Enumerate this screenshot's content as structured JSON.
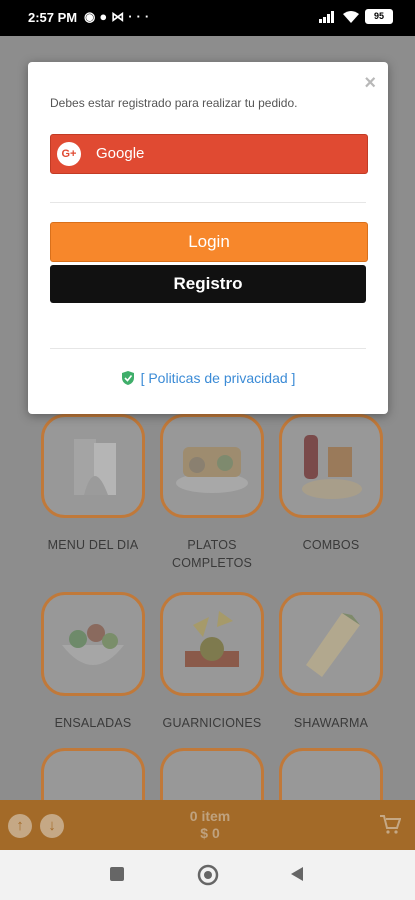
{
  "status_bar": {
    "time": "2:57 PM",
    "left_icons": [
      "whatsapp-icon",
      "chat-icon",
      "sync-icon",
      "more-dots-icon"
    ],
    "battery": "95"
  },
  "modal": {
    "message": "Debes estar registrado para realizar tu pedido.",
    "close": "×",
    "google_icon": "G+",
    "google_label": "Google",
    "login_label": "Login",
    "registro_label": "Registro",
    "privacy_label": "[ Politicas de privacidad ]",
    "colors": {
      "google": "#e04a32",
      "login": "#f7872b",
      "registro": "#111111",
      "link": "#3b8bd6"
    }
  },
  "categories": [
    {
      "label": "MENU DEL DIA",
      "icon": "menu-card-icon"
    },
    {
      "label": "PLATOS\nCOMPLETOS",
      "icon": "platter-icon"
    },
    {
      "label": "COMBOS",
      "icon": "combo-icon"
    },
    {
      "label": "ENSALADAS",
      "icon": "salad-icon"
    },
    {
      "label": "GUARNICIONES",
      "icon": "nachos-icon"
    },
    {
      "label": "SHAWARMA",
      "icon": "wrap-icon"
    }
  ],
  "cart": {
    "items": "0 item",
    "total": "$ 0",
    "up_arrow": "↑",
    "down_arrow": "↓"
  },
  "accent_color": "#f7872b"
}
